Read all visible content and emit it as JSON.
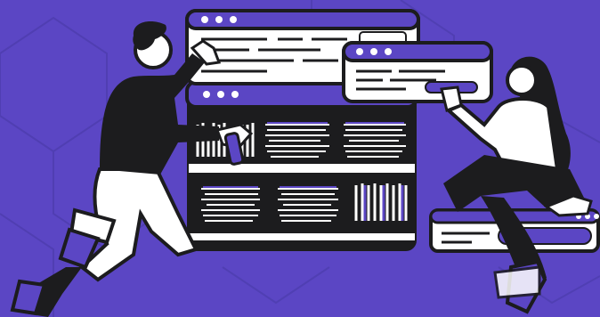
{
  "theme": {
    "background": "#5b46c4",
    "pattern": "#5140b4",
    "ink": "#1c1c1e",
    "paper": "#ffffff",
    "accent": "#5b46c4"
  },
  "icons": {
    "window_dots": "three-dot-window-icon",
    "browser_window": "browser-window-icon",
    "person_left": "man-reaching-icon",
    "person_right": "woman-sitting-icon"
  }
}
